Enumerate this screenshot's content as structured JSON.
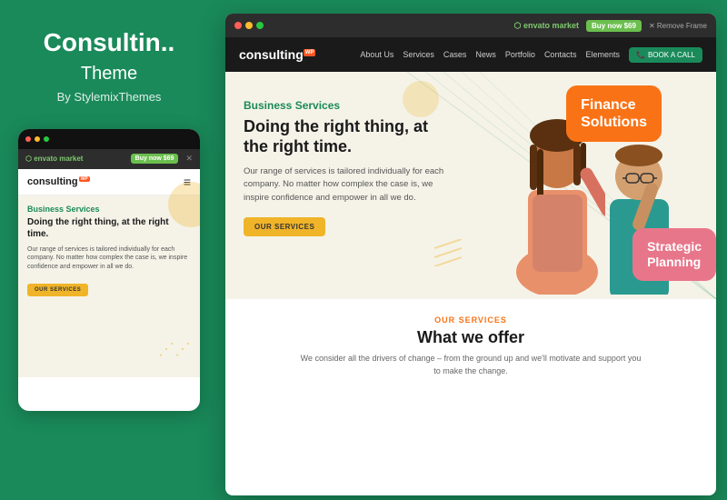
{
  "left": {
    "title": "Consultin..",
    "subtitle": "Theme",
    "author": "By StylemixThemes"
  },
  "mobile": {
    "envato_logo": "envato market",
    "buy_btn": "Buy now $69",
    "logo": "consulting",
    "logo_badge": "WP",
    "business_label": "Business Services",
    "headline": "Doing the right thing, at the right time.",
    "body_text": "Our range of services is tailored individually for each company. No matter how complex the case is, we inspire confidence and empower in all we do.",
    "services_btn": "OUR SERVICES"
  },
  "desktop": {
    "envato_logo": "envato market",
    "buy_btn": "Buy now $69",
    "remove_link": "✕ Remove Frame",
    "logo": "consulting",
    "logo_badge": "WP",
    "nav": {
      "about": "About Us",
      "services": "Services",
      "cases": "Cases",
      "news": "News",
      "portfolio": "Portfolio",
      "contacts": "Contacts",
      "elements": "Elements",
      "book_btn": "BOOK A CALL"
    },
    "hero": {
      "business_label": "Business Services",
      "headline": "Doing the right thing, at the right time.",
      "body_text": "Our range of services is tailored individually for each company. No matter how complex the case is, we inspire confidence and empower in all we do.",
      "services_btn": "OUR SERVICES",
      "bubble_orange_line1": "Finance",
      "bubble_orange_line2": "Solutions",
      "bubble_pink_line1": "Strategic",
      "bubble_pink_line2": "Planning"
    },
    "below": {
      "our_services_label": "OUR SERVICES",
      "headline": "What we offer",
      "description": "We consider all the drivers of change – from the ground up and we'll motivate and support you to make the change."
    }
  },
  "colors": {
    "green": "#1a8a5a",
    "orange": "#f97316",
    "yellow": "#f0b429",
    "dark": "#1a1a1a"
  },
  "dots": {
    "red": "#ff5f57",
    "yellow": "#febc2e",
    "green": "#28c840"
  }
}
